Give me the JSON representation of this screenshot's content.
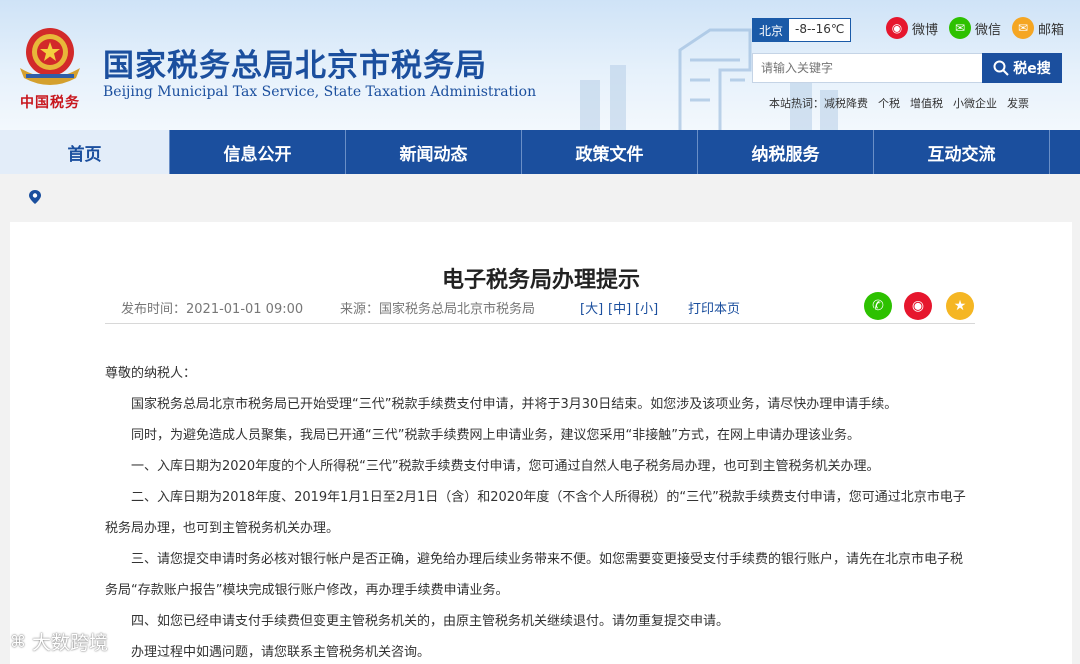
{
  "header": {
    "emblem_caption": "中国税务",
    "title": "国家税务总局北京市税务局",
    "subtitle": "Beijing Municipal Tax Service, State Taxation Administration",
    "weather": {
      "city": "北京",
      "temp": "-8--16℃"
    },
    "social": [
      {
        "label": "微博",
        "icon": "weibo-icon",
        "color": "#e6162d"
      },
      {
        "label": "微信",
        "icon": "wechat-icon",
        "color": "#2dc100"
      },
      {
        "label": "邮箱",
        "icon": "mail-icon",
        "color": "#f5a623"
      }
    ],
    "search": {
      "placeholder": "请输入关键字",
      "button": "税e搜"
    },
    "hot": {
      "label": "本站热词：减税降费",
      "items": [
        "个税",
        "增值税",
        "小微企业",
        "发票"
      ]
    }
  },
  "nav": {
    "items": [
      "首页",
      "信息公开",
      "新闻动态",
      "政策文件",
      "纳税服务",
      "互动交流"
    ],
    "active": "首页",
    "active_bg": "#e3edf9",
    "bar_color": "#1b4f9e"
  },
  "article": {
    "title": "电子税务局办理提示",
    "publish_time": "发布时间：2021-01-01 09:00",
    "source": "来源：国家税务总局北京市税务局",
    "font_size": {
      "large": "[大]",
      "medium": "[中]",
      "small": "[小]"
    },
    "print": "打印本页",
    "share": [
      {
        "icon": "wechat-share-icon",
        "color": "#2dc100"
      },
      {
        "icon": "weibo-share-icon",
        "color": "#e6162d"
      },
      {
        "icon": "favorite-star-icon",
        "color": "#f5b623"
      }
    ],
    "greeting": "尊敬的纳税人：",
    "paragraphs": [
      "国家税务总局北京市税务局已开始受理“三代”税款手续费支付申请，并将于3月30日结束。如您涉及该项业务，请尽快办理申请手续。",
      "同时，为避免造成人员聚集，我局已开通“三代”税款手续费网上申请业务，建议您采用“非接触”方式，在网上申请办理该业务。",
      "一、入库日期为2020年度的个人所得税“三代”税款手续费支付申请，您可通过自然人电子税务局办理，也可到主管税务机关办理。",
      "二、入库日期为2018年度、2019年1月1日至2月1日（含）和2020年度（不含个人所得税）的“三代”税款手续费支付申请，您可通过北京市电子税务局办理，也可到主管税务机关办理。",
      "三、请您提交申请时务必核对银行帐户是否正确，避免给办理后续业务带来不便。如您需要变更接受支付手续费的银行账户，请先在北京市电子税务局“存款账户报告”模块完成银行账户修改，再办理手续费申请业务。",
      "四、如您已经申请支付手续费但变更主管税务机关的，由原主管税务机关继续退付。请勿重复提交申请。",
      "办理过程中如遇问题，请您联系主管税务机关咨询。"
    ]
  },
  "watermark": "大数跨境"
}
